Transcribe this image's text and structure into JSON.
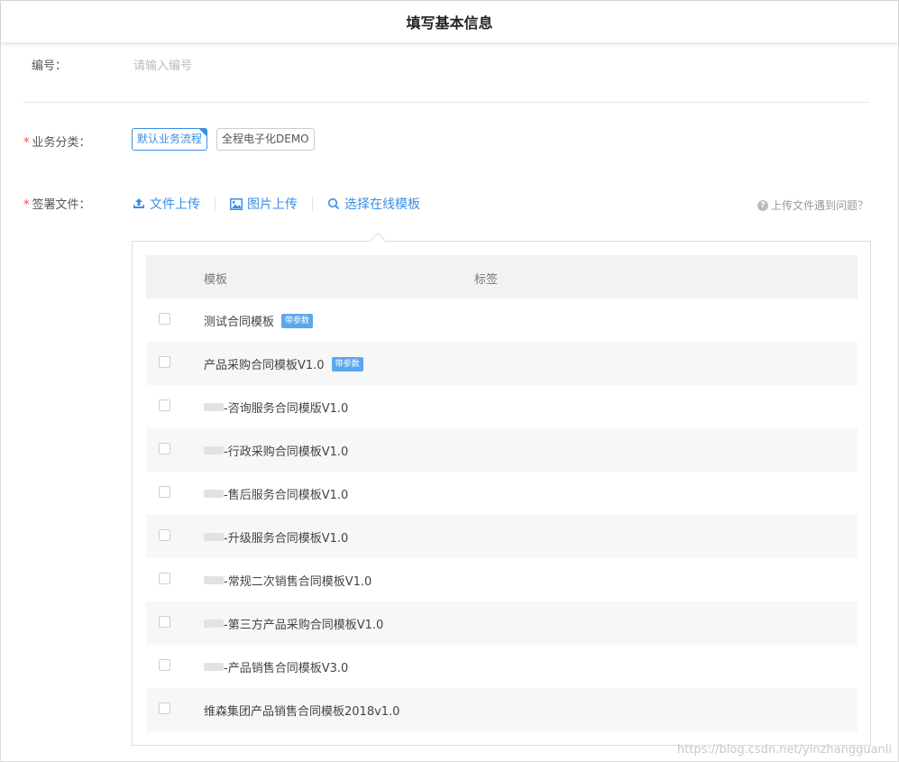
{
  "header": {
    "title": "填写基本信息"
  },
  "form": {
    "number": {
      "label": "编号：",
      "placeholder": "请输入编号"
    },
    "business_category": {
      "label": "业务分类：",
      "options": [
        {
          "label": "默认业务流程",
          "selected": true
        },
        {
          "label": "全程电子化DEMO",
          "selected": false
        }
      ]
    },
    "sign_files": {
      "label": "签署文件：",
      "actions": [
        {
          "label": "文件上传",
          "icon": "upload-icon"
        },
        {
          "label": "图片上传",
          "icon": "image-icon"
        },
        {
          "label": "选择在线模板",
          "icon": "search-icon"
        }
      ],
      "help": "上传文件遇到问题？"
    }
  },
  "table": {
    "columns": [
      "模板",
      "标签"
    ],
    "rows": [
      {
        "name": "测试合同模板",
        "badge": "带参数",
        "blurred_prefix": false
      },
      {
        "name": "产品采购合同模板V1.0",
        "badge": "带参数",
        "blurred_prefix": false
      },
      {
        "name": "-咨询服务合同模版V1.0",
        "badge": "",
        "blurred_prefix": true
      },
      {
        "name": "-行政采购合同模板V1.0",
        "badge": "",
        "blurred_prefix": true
      },
      {
        "name": "-售后服务合同模板V1.0",
        "badge": "",
        "blurred_prefix": true
      },
      {
        "name": "-升级服务合同模板V1.0",
        "badge": "",
        "blurred_prefix": true
      },
      {
        "name": "-常规二次销售合同模板V1.0",
        "badge": "",
        "blurred_prefix": true
      },
      {
        "name": "-第三方产品采购合同模板V1.0",
        "badge": "",
        "blurred_prefix": true
      },
      {
        "name": "-产品销售合同模板V3.0",
        "badge": "",
        "blurred_prefix": true
      },
      {
        "name": "维森集团产品销售合同模板2018v1.0",
        "badge": "",
        "blurred_prefix": false
      }
    ]
  },
  "watermark": "https://blog.csdn.net/yinzhangguanli",
  "colors": {
    "accent": "#3a8ee6",
    "required": "#e54d42",
    "badge": "#5aa8ee"
  }
}
